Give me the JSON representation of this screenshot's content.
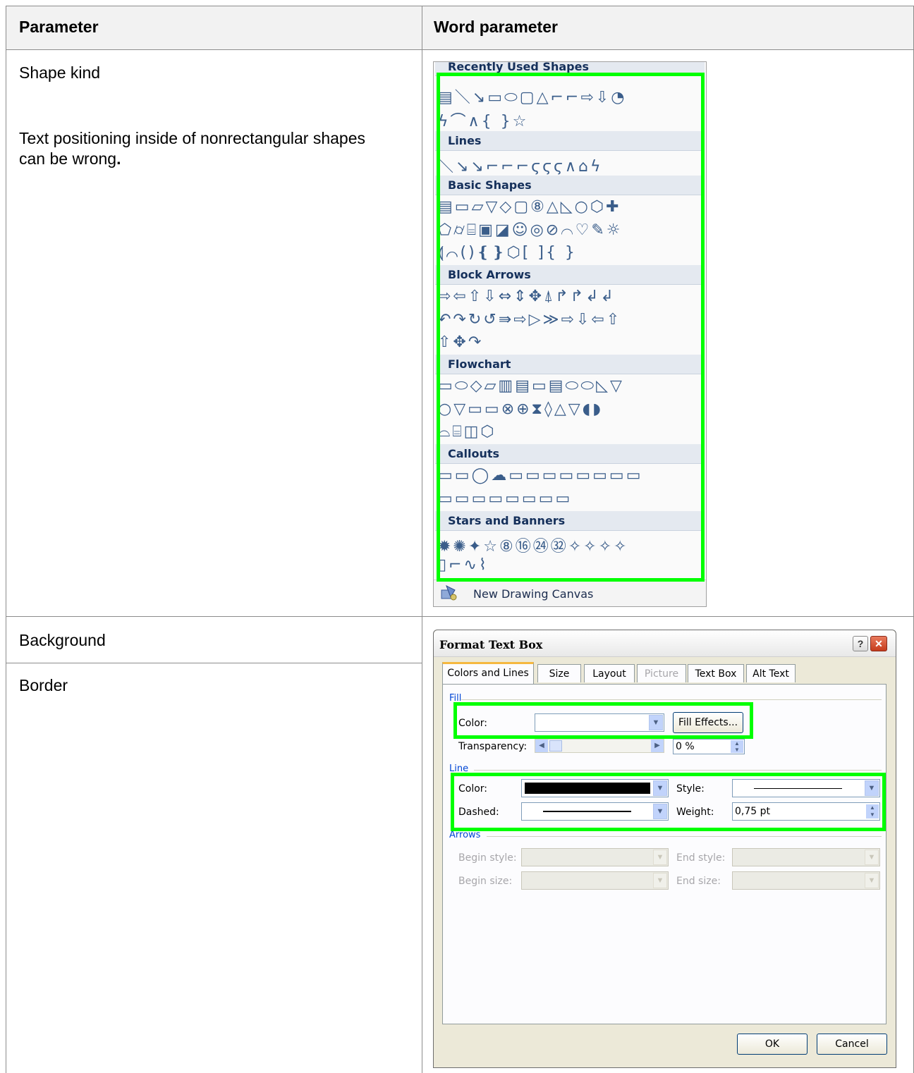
{
  "table": {
    "headers": [
      "Parameter",
      "Word parameter"
    ],
    "row1": {
      "param": "Shape kind",
      "note": "Text positioning inside of nonrectangular shapes can be wrong",
      "note_end": "."
    },
    "row2": {
      "param": "Background"
    },
    "row3": {
      "param": "Border"
    }
  },
  "shapes_gallery": {
    "sections": [
      {
        "title": "Recently Used Shapes",
        "rows": [
          "▤＼↘▭⬭▢△⌐⌐⇨⇩◔",
          "ϟ⌒∧{ }☆"
        ]
      },
      {
        "title": "Lines",
        "rows": [
          "＼↘↘⌐⌐⌐ϛϛϛ∧⌂ϟ"
        ]
      },
      {
        "title": "Basic Shapes",
        "rows": [
          "▤▭▱▽◇▢⑧△◺○⬡✚",
          "⬠⌭⌸▣◪☺◎⊘⌒♡✎☼",
          "⟬⌒()❴❵⬡[ ]{ }"
        ]
      },
      {
        "title": "Block Arrows",
        "rows": [
          "⇨⇦⇧⇩⇔⇕✥⍋↱↱↲↲",
          "↶↷↻↺⇛⇨▷≫⇨⇩⇦⇧",
          "⇧✥↷"
        ]
      },
      {
        "title": "Flowchart",
        "rows": [
          "▭⬭◇▱▥▤▭▤⬭⬭◺▽",
          "○▽▭▭⊗⊕⧗◊△▽◖◗",
          "⌓⌸◫⬡"
        ]
      },
      {
        "title": "Callouts",
        "rows": [
          "▭▭◯☁▭▭▭▭▭▭▭▭",
          "▭▭▭▭▭▭▭▭"
        ]
      },
      {
        "title": "Stars and Banners",
        "rows": [
          "✹✺✦☆⑧⑯㉔㉜✧✧✧✧",
          "▯⌐∿⌇"
        ]
      }
    ],
    "footer_link": "New Drawing Canvas"
  },
  "dialog": {
    "title": "Format Text Box",
    "help": "?",
    "close": "✕",
    "tabs": [
      "Colors and Lines",
      "Size",
      "Layout",
      "Picture",
      "Text Box",
      "Alt Text"
    ],
    "fill": {
      "section": "Fill",
      "color_label": "Color:",
      "fill_effects": "Fill Effects...",
      "transparency_label": "Transparency:",
      "transparency_value": "0 %"
    },
    "line": {
      "section": "Line",
      "color_label": "Color:",
      "style_label": "Style:",
      "dashed_label": "Dashed:",
      "weight_label": "Weight:",
      "weight_value": "0,75 pt"
    },
    "arrows": {
      "section": "Arrows",
      "begin_style": "Begin style:",
      "end_style": "End style:",
      "begin_size": "Begin size:",
      "end_size": "End size:"
    },
    "ok": "OK",
    "cancel": "Cancel"
  },
  "colors": {
    "highlight": "#00ff00",
    "grid": "#8c8c8c",
    "header_bg": "#f2f2f2"
  }
}
